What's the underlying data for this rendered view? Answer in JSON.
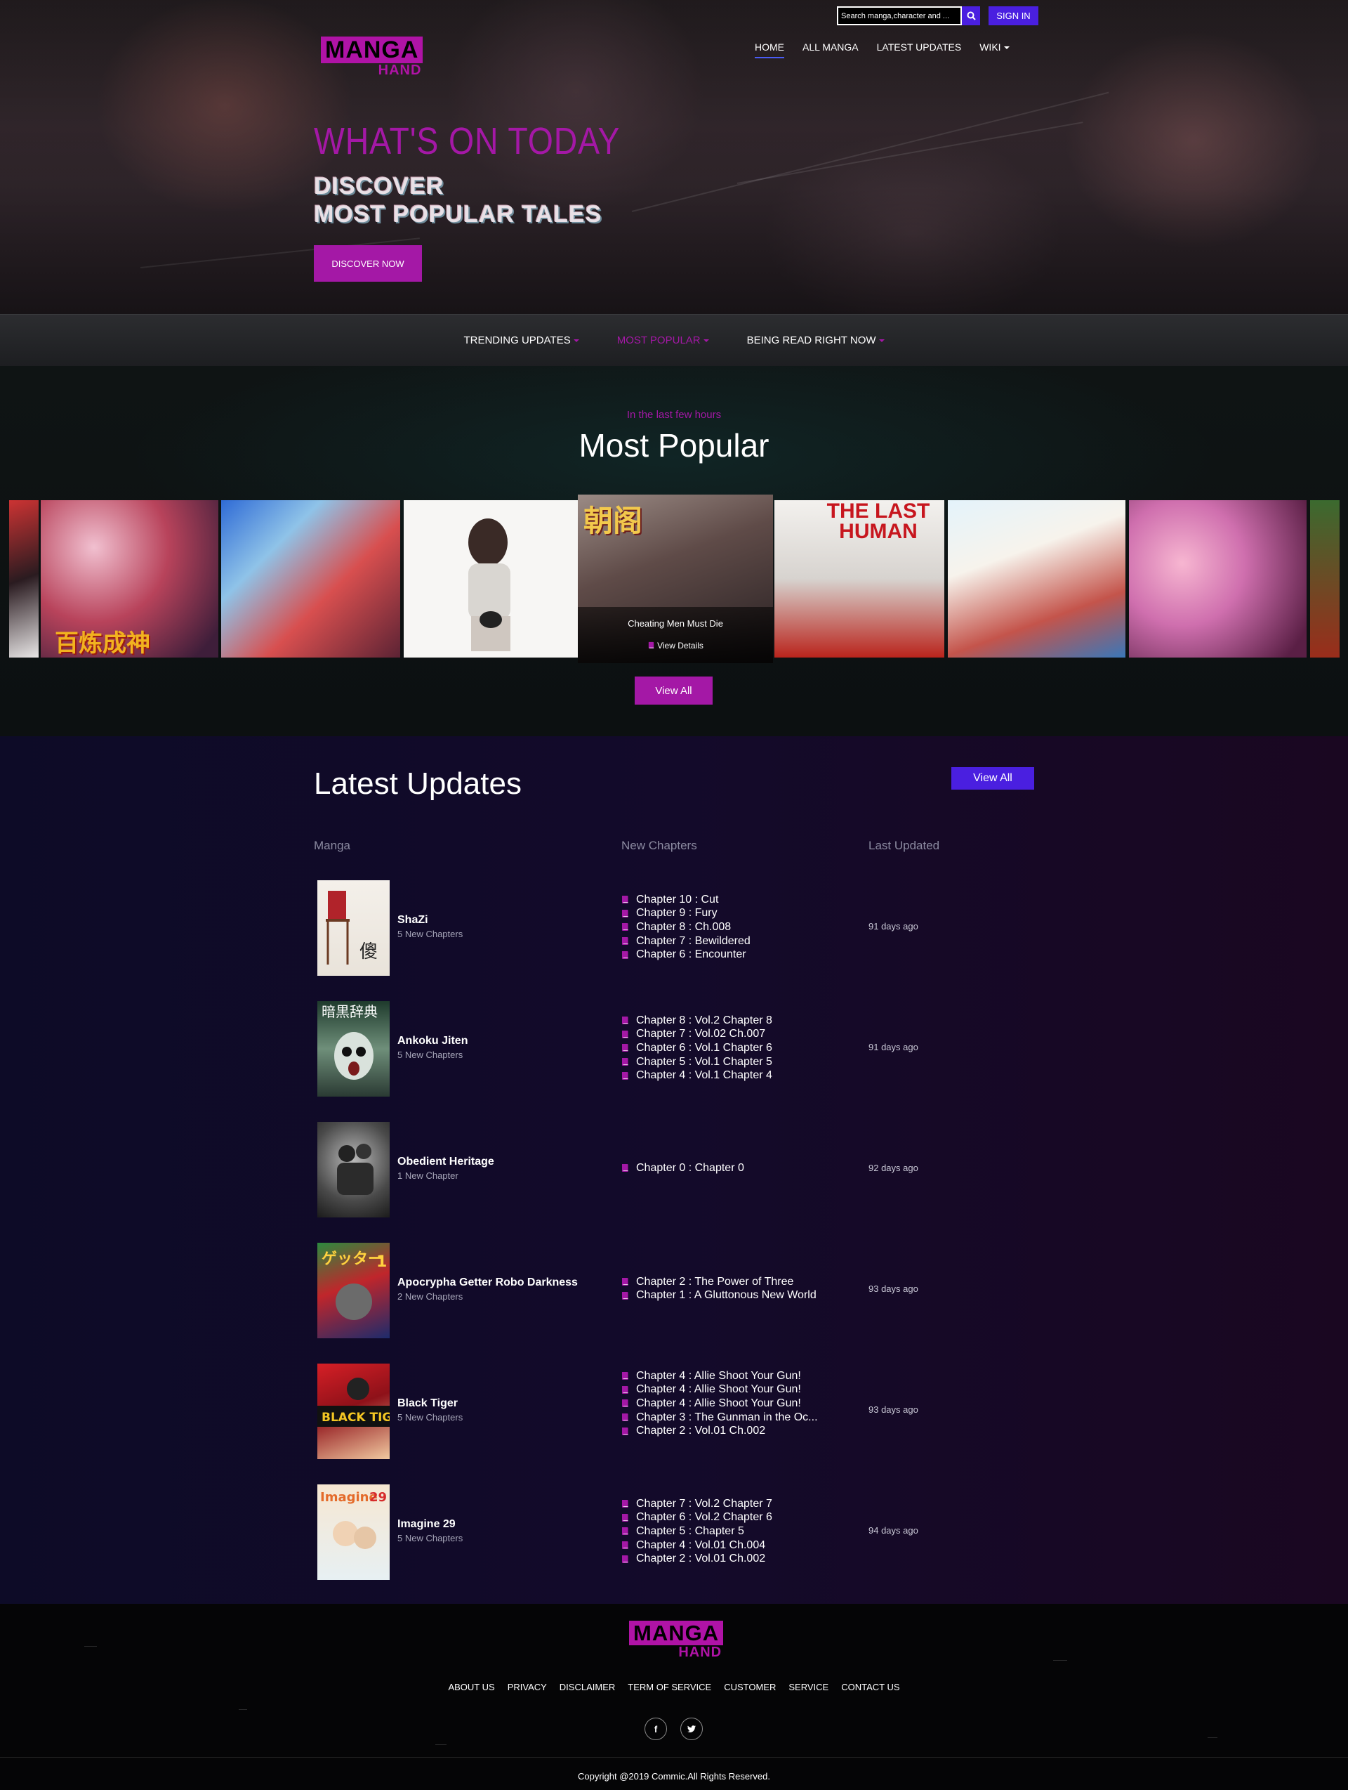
{
  "header": {
    "search_placeholder": "Search manga,character and ...",
    "signin_label": "SIGN IN",
    "logo_top": "MANGA",
    "logo_bottom": "HAND",
    "nav": [
      {
        "label": "HOME",
        "active": true
      },
      {
        "label": "ALL MANGA",
        "active": false
      },
      {
        "label": "LATEST UPDATES",
        "active": false
      },
      {
        "label": "WIKI",
        "active": false
      }
    ]
  },
  "hero": {
    "title": "WHAT'S ON TODAY",
    "line1": "DISCOVER",
    "line2": "MOST POPULAR TALES",
    "button": "DISCOVER NOW"
  },
  "tabs": [
    {
      "label": "TRENDING UPDATES",
      "active": false
    },
    {
      "label": "MOST POPULAR",
      "active": true
    },
    {
      "label": "BEING READ RIGHT NOW",
      "active": false
    }
  ],
  "popular": {
    "kicker": "In the last few hours",
    "title": "Most Popular",
    "featured_title": "Cheating Men Must Die",
    "featured_details": "View Details",
    "view_all": "View All",
    "cover_texts": [
      "百炼成神",
      "THE LAST HUMAN",
      "朝阁"
    ]
  },
  "latest": {
    "title": "Latest Updates",
    "view_all": "View All",
    "columns": [
      "Manga",
      "New Chapters",
      "Last Updated"
    ],
    "rows": [
      {
        "name": "ShaZi",
        "count": "5 New Chapters",
        "updated": "91 days ago",
        "chapters": [
          "Chapter 10 : Cut",
          "Chapter 9 : Fury",
          "Chapter 8 : Ch.008",
          "Chapter 7 : Bewildered",
          "Chapter 6 : Encounter"
        ]
      },
      {
        "name": "Ankoku Jiten",
        "count": "5 New Chapters",
        "updated": "91 days ago",
        "chapters": [
          "Chapter 8 : Vol.2 Chapter 8",
          "Chapter 7 : Vol.02 Ch.007",
          "Chapter 6 : Vol.1 Chapter 6",
          "Chapter 5 : Vol.1 Chapter 5",
          "Chapter 4 : Vol.1 Chapter 4"
        ]
      },
      {
        "name": "Obedient Heritage",
        "count": "1 New Chapter",
        "updated": "92 days ago",
        "chapters": [
          "Chapter 0 : Chapter 0"
        ]
      },
      {
        "name": "Apocrypha Getter Robo Darkness",
        "count": "2 New Chapters",
        "updated": "93 days ago",
        "chapters": [
          "Chapter 2 : The Power of Three",
          "Chapter 1 : A Gluttonous New World"
        ]
      },
      {
        "name": "Black Tiger",
        "count": "5 New Chapters",
        "updated": "93 days ago",
        "chapters": [
          "Chapter 4 : Allie Shoot Your Gun!",
          "Chapter 4 : Allie Shoot Your Gun!",
          "Chapter 4 : Allie Shoot Your Gun!",
          "Chapter 3 : The Gunman in the Oc...",
          "Chapter 2 : Vol.01 Ch.002"
        ]
      },
      {
        "name": "Imagine 29",
        "count": "5 New Chapters",
        "updated": "94 days ago",
        "chapters": [
          "Chapter 7 : Vol.2 Chapter 7",
          "Chapter 6 : Vol.2 Chapter 6",
          "Chapter 5 : Chapter 5",
          "Chapter 4 : Vol.01 Ch.004",
          "Chapter 2 : Vol.01 Ch.002"
        ]
      }
    ]
  },
  "footer": {
    "links": [
      "ABOUT US",
      "PRIVACY",
      "DISCLAIMER",
      "TERM OF SERVICE",
      "CUSTOMER",
      "SERVICE",
      "CONTACT US"
    ],
    "social": [
      "f",
      "t"
    ],
    "copyright": "Copyright @2019 Commic.All Rights Reserved."
  },
  "colors": {
    "accent_magenta": "#a418a6",
    "accent_blue": "#4a1fe0"
  },
  "icons": [
    "search-icon",
    "book-icon",
    "facebook-icon",
    "twitter-icon",
    "caret-down-icon"
  ]
}
